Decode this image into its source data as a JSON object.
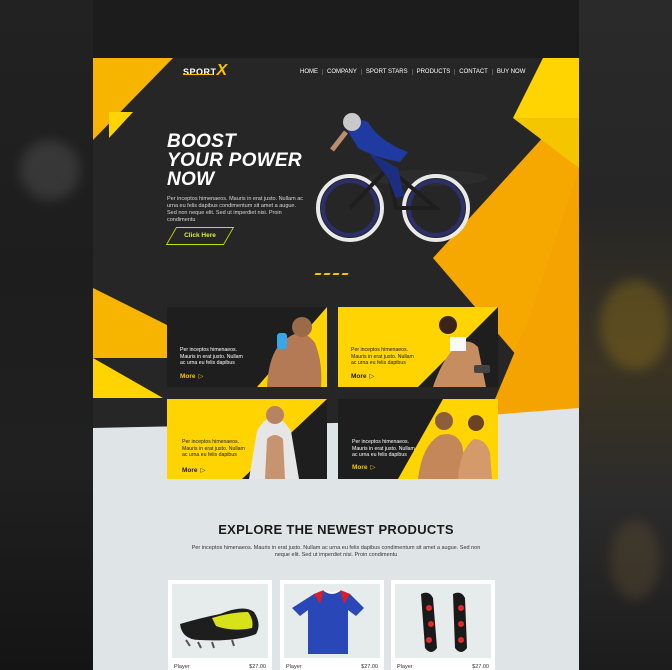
{
  "header": {
    "logo_text": "SPORT",
    "logo_mark": "X",
    "nav": [
      "HOME",
      "COMPANY",
      "SPORT STARS",
      "PRODUCTS",
      "CONTACT",
      "BUY NOW"
    ]
  },
  "hero": {
    "title_lines": [
      "BOOST",
      "YOUR POWER",
      "NOW"
    ],
    "body": "Per inceptos himenaeos. Mauris in erat justo. Nullam ac urna eu felis dapibus condimentum sit amet a augue. Sed non neque elit. Sed ut imperdiet nisi. Proin condimentu",
    "cta_label": "Click Here",
    "slider_dots": 4
  },
  "cards": [
    {
      "text": "Per inceptos himenaeos. Mauris in erat justo. Nullam ac urna eu felis dapibus",
      "more": "More",
      "arrow": "▷"
    },
    {
      "text": "Per inceptos himenaeos. Mauris in erat justo. Nullam ac urna eu felis dapibus",
      "more": "More",
      "arrow": "▷"
    },
    {
      "text": "Per inceptos himenaeos. Mauris in erat justo. Nullam ac urna eu felis dapibus",
      "more": "More",
      "arrow": "▷"
    },
    {
      "text": "Per inceptos himenaeos. Mauris in erat justo. Nullam ac urna eu felis dapibus",
      "more": "More",
      "arrow": "▷"
    }
  ],
  "products_section": {
    "title": "EXPLORE THE NEWEST PRODUCTS",
    "body": "Per inceptos himenaeos. Mauris in erat justo. Nullam ac urna eu felis dapibus condimentum sit amet a augue. Sed non neque elit. Sed ut imperdiet nisi. Proin condimentu",
    "items": [
      {
        "name": "Player",
        "price": "$27.00",
        "icon": "football-boot-icon"
      },
      {
        "name": "Player",
        "price": "$27.00",
        "icon": "jersey-icon"
      },
      {
        "name": "Player",
        "price": "$27.00",
        "icon": "cleats-icon"
      }
    ]
  },
  "colors": {
    "accent_yellow": "#f7c200",
    "accent_orange": "#f5a800",
    "cta_green": "#c6e000",
    "dark": "#262626",
    "light_bg": "#dfe5e6"
  }
}
